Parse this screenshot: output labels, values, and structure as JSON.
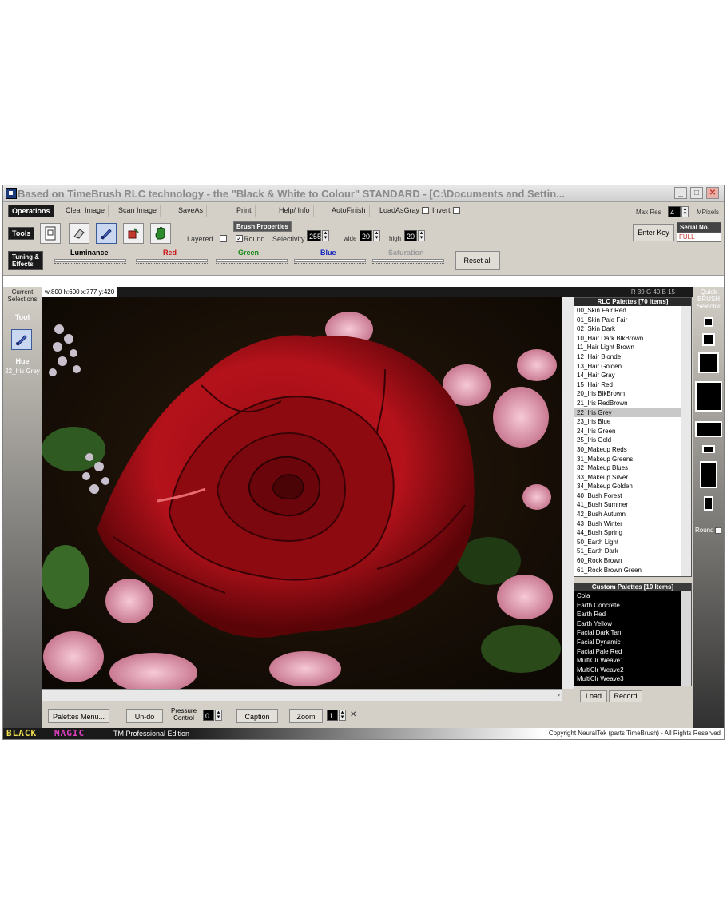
{
  "window": {
    "title": "Based on TimeBrush RLC technology - the \"Black & White to Colour\" STANDARD - [C:\\Documents and Settin..."
  },
  "operations": {
    "label": "Operations",
    "buttons": [
      "Clear Image",
      "Scan Image",
      "SaveAs",
      "Print",
      "Help/ Info",
      "AutoFinish",
      "LoadAsGray",
      "Invert"
    ],
    "max_res_label": "Max Res",
    "max_res_value": "4",
    "mpixels_label": "MPixels"
  },
  "tools": {
    "label": "Tools",
    "layered_label": "Layered",
    "brush_properties_label": "Brush Properties",
    "round_label": "Round",
    "selectivity_label": "Selectivity",
    "selectivity_value": "255",
    "wide_label": "wide",
    "wide_value": "20",
    "high_label": "high",
    "high_value": "20",
    "enter_key_label": "Enter Key",
    "serial_label": "Serial No.",
    "serial_value": "FULL"
  },
  "tuning": {
    "label_line1": "Tuning &",
    "label_line2": "Effects",
    "luminance": "Luminance",
    "red": "Red",
    "green": "Green",
    "blue": "Blue",
    "saturation": "Saturation",
    "reset_label": "Reset all",
    "colors": {
      "red": "#cc1111",
      "green": "#118811",
      "blue": "#1122bb",
      "saturation": "#888888"
    }
  },
  "left_panel": {
    "current_selections": "Current Selections",
    "tool_label": "Tool",
    "hue_label": "Hue",
    "hue_value": "22_Iris Gray"
  },
  "canvas": {
    "info": "w:800  h:600  x:777  y:420",
    "rgb": "R 39 G 40 B 15"
  },
  "rlc_palettes": {
    "header": "RLC Palettes [70 Items]",
    "items": [
      "00_Skin Fair Red",
      "01_Skin Pale Fair",
      "02_Skin Dark",
      "10_Hair Dark BlkBrown",
      "11_Hair Light Brown",
      "12_Hair Blonde",
      "13_Hair Golden",
      "14_Hair Gray",
      "15_Hair Red",
      "20_Iris BlkBrown",
      "21_Iris RedBrown",
      "22_Iris Grey",
      "23_Iris Blue",
      "24_Iris Green",
      "25_Iris Gold",
      "30_Makeup Reds",
      "31_Makeup Greens",
      "32_Makeup Blues",
      "33_Makeup Silver",
      "34_Makeup Golden",
      "40_Bush Forest",
      "41_Bush Summer",
      "42_Bush Autumn",
      "43_Bush Winter",
      "44_Bush Spring",
      "50_Earth Light",
      "51_Earth Dark",
      "60_Rock Brown",
      "61_Rock Brown Green"
    ],
    "selected": "22_Iris Grey"
  },
  "custom_palettes": {
    "header": "Custom Palettes [10 Items]",
    "items": [
      "Cola",
      "Earth Concrete",
      "Earth Red",
      "Earth Yellow",
      "Facial Dark Tan",
      "Facial Dynamic",
      "Facial Pale Red",
      "MultiClr Weave1",
      "MultiClr Weave2",
      "MultiClr Weave3"
    ],
    "load_label": "Load",
    "record_label": "Record"
  },
  "quick_brush": {
    "label": "Quick BRUSH Selector",
    "round_label": "Round"
  },
  "bottom": {
    "palettes_menu": "Palettes Menu...",
    "undo": "Un-do",
    "pressure_line1": "Pressure",
    "pressure_line2": "Control",
    "pressure_value": "0",
    "caption": "Caption",
    "zoom": "Zoom",
    "zoom_value": "1",
    "zoom_close": "✕"
  },
  "status": {
    "brand_black": "BLACK",
    "brand_magic": "MAGIC",
    "edition": "TM Professional Edition",
    "copyright": "Copyright NeuralTek (parts TimeBrush) - All Rights Reserved"
  }
}
